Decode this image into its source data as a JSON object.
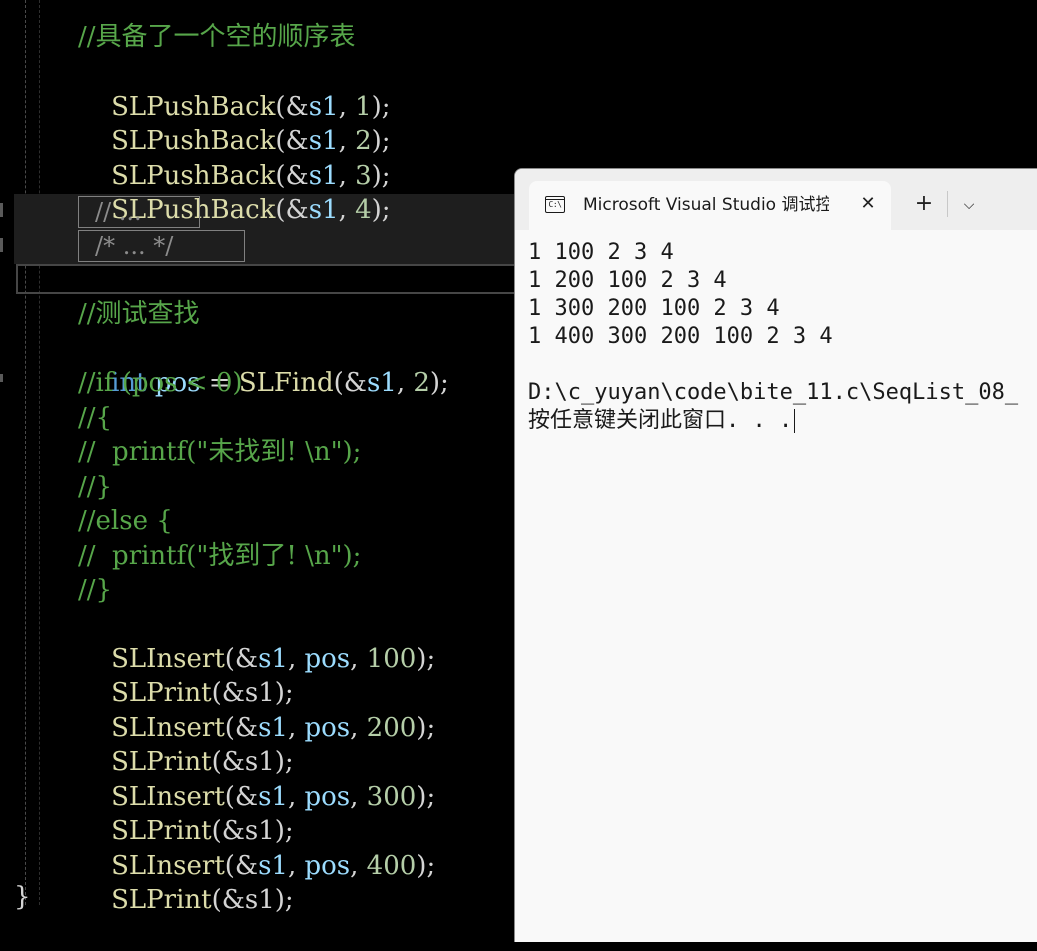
{
  "editor": {
    "lines": [
      "//具备了一个空的顺序表",
      "SLPushBack(&s1, 1);",
      "SLPushBack(&s1, 2);",
      "SLPushBack(&s1, 3);",
      "SLPushBack(&s1, 4);",
      "// ...",
      "/* ... */",
      "",
      "//测试查找",
      "int pos = SLFind(&s1, 2);",
      "//if (pos < 0)",
      "//{",
      "//  printf(\"未找到! \\n\");",
      "//}",
      "//else {",
      "//  printf(\"找到了! \\n\");",
      "//}",
      "SLInsert(&s1, pos, 100);",
      "SLPrint(&s1);",
      "SLInsert(&s1, pos, 200);",
      "SLPrint(&s1);",
      "SLInsert(&s1, pos, 300);",
      "SLPrint(&s1);",
      "SLInsert(&s1, pos, 400);",
      "SLPrint(&s1);",
      "}"
    ],
    "tokens": {
      "comment_title": "//具备了一个空的顺序表",
      "fn_pushback": "SLPushBack",
      "lparen_amp": "(&",
      "var_s1": "s1",
      "comma": ", ",
      "rparen_semi": ");",
      "num_1": "1",
      "num_2": "2",
      "num_3": "3",
      "num_4": "4",
      "fold_line_comment": "// ...",
      "fold_block_comment": "/* ... */",
      "comment_test_find": "//测试查找",
      "kw_int": "int",
      "var_pos": "pos",
      "assign": " = ",
      "fn_find": "SLFind",
      "comment_if": "//if (pos < 0)",
      "comment_open_brace": "//{",
      "comment_printf_not_found": "//  printf(\"未找到! \\n\");",
      "comment_close_brace": "//}",
      "comment_else": "//else {",
      "comment_printf_found": "//  printf(\"找到了! \\n\");",
      "fn_insert": "SLInsert",
      "fn_print": "SLPrint",
      "paren_amp_s1_close": "(&s1);",
      "num_100": "100",
      "num_200": "200",
      "num_300": "300",
      "num_400": "400",
      "closing_brace": "}"
    },
    "colors": {
      "background": "#000000",
      "function": "#dcdcaa",
      "number": "#b5cea8",
      "variable": "#9cdcfe",
      "keyword": "#569cd6",
      "comment": "#57a64a",
      "punctuation": "#d4d4d4"
    }
  },
  "console": {
    "tab_icon": "terminal-icon",
    "tab_icon_text": "C:\\",
    "tab_title": "Microsoft Visual Studio 调试控制台",
    "close_label": "✕",
    "new_tab_label": "+",
    "dropdown_label": "⌵",
    "output": [
      "1 100 2 3 4",
      "1 200 100 2 3 4",
      "1 300 200 100 2 3 4",
      "1 400 300 200 100 2 3 4",
      "",
      "D:\\c_yuyan\\code\\bite_11.c\\SeqList_08_",
      "按任意键关闭此窗口. . ."
    ],
    "colors": {
      "background": "#f9f9f9",
      "titlebar": "#eeeeee",
      "text": "#1a1a1a"
    }
  }
}
